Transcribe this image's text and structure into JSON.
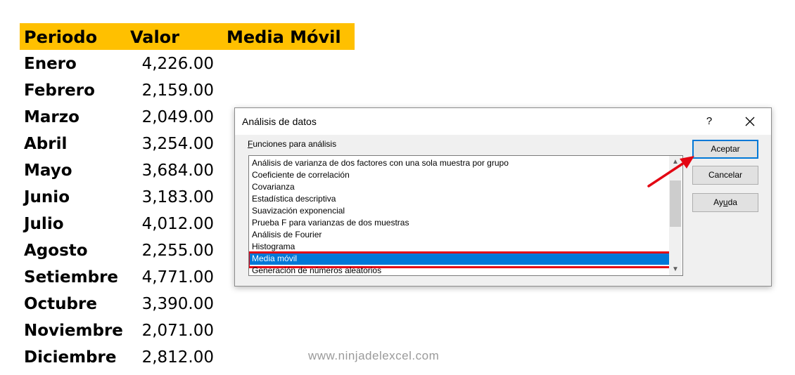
{
  "sheet": {
    "headers": [
      "Periodo",
      "Valor",
      "Media Móvil"
    ],
    "header_color": "#FFC000",
    "rows": [
      {
        "periodo": "Enero",
        "valor": "4,226.00"
      },
      {
        "periodo": "Febrero",
        "valor": "2,159.00"
      },
      {
        "periodo": "Marzo",
        "valor": "2,049.00"
      },
      {
        "periodo": "Abril",
        "valor": "3,254.00"
      },
      {
        "periodo": "Mayo",
        "valor": "3,684.00"
      },
      {
        "periodo": "Junio",
        "valor": "3,183.00"
      },
      {
        "periodo": "Julio",
        "valor": "4,012.00"
      },
      {
        "periodo": "Agosto",
        "valor": "2,255.00"
      },
      {
        "periodo": "Setiembre",
        "valor": "4,771.00"
      },
      {
        "periodo": "Octubre",
        "valor": "3,390.00"
      },
      {
        "periodo": "Noviembre",
        "valor": "2,071.00"
      },
      {
        "periodo": "Diciembre",
        "valor": "2,812.00"
      }
    ]
  },
  "dialog": {
    "title": "Análisis de datos",
    "help_label": "?",
    "close_icon": "close-icon",
    "list_label_first": "F",
    "list_label_rest": "unciones para análisis",
    "items": [
      "Análisis de varianza de dos factores con una sola muestra por grupo",
      "Coeficiente de correlación",
      "Covarianza",
      "Estadística descriptiva",
      "Suavización exponencial",
      "Prueba F para varianzas de dos muestras",
      "Análisis de Fourier",
      "Histograma",
      "Media móvil",
      "Generación de números aleatorios"
    ],
    "selected_item": "Media móvil",
    "selection_color": "#0078D7",
    "highlight_color": "#e30613",
    "buttons": {
      "accept": "Aceptar",
      "cancel": "Cancelar",
      "help_prefix": "Ay",
      "help_underline": "u",
      "help_suffix": "da"
    }
  },
  "watermark": "www.ninjadelexcel.com"
}
